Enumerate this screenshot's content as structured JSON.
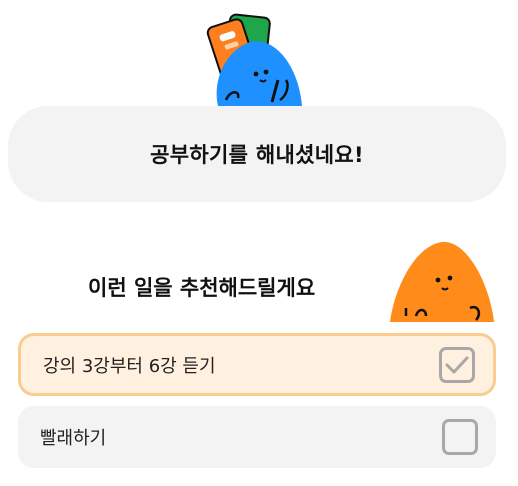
{
  "banner": {
    "text": "공부하기를 해내셨네요!"
  },
  "recommend": {
    "title": "이런 일을 추천해드릴게요"
  },
  "tasks": [
    {
      "label": "강의 3강부터 6강 듣기",
      "checked": true
    },
    {
      "label": "빨래하기",
      "checked": false
    }
  ],
  "icons": {
    "hero": "book-character-icon",
    "side": "orange-blob-character-icon",
    "check": "check-icon"
  },
  "colors": {
    "selected_bg": "#fff0e0",
    "selected_border": "#f9cc91",
    "card_bg": "#f3f3f3",
    "checkbox_border": "#a8a8a8",
    "blob_blue": "#1e90ff",
    "blob_orange": "#ff8c1a"
  }
}
